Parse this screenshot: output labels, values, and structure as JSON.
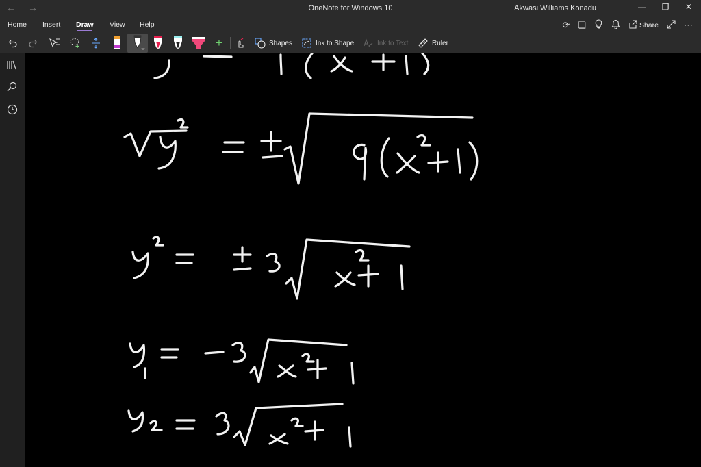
{
  "titlebar": {
    "app_title": "OneNote for Windows 10",
    "user_name": "Akwasi Williams Konadu",
    "back_icon": "back-arrow-icon",
    "forward_icon": "forward-arrow-icon",
    "minimize_glyph": "—",
    "restore_glyph": "❐",
    "close_glyph": "✕"
  },
  "tabs": [
    {
      "label": "Home"
    },
    {
      "label": "Insert"
    },
    {
      "label": "Draw"
    },
    {
      "label": "View"
    },
    {
      "label": "Help"
    }
  ],
  "active_tab": "Draw",
  "header_right": {
    "share_label": "Share"
  },
  "toolbar": {
    "shapes_label": "Shapes",
    "ink_to_shape_label": "Ink to Shape",
    "ink_to_text_label": "Ink to Text",
    "ruler_label": "Ruler",
    "pen_colors": {
      "pen1": "#c13ad1",
      "pen2": "#ffffff",
      "pen3": "#e8204f",
      "pen4": "#ffffff",
      "highlighter": "#f0487a"
    },
    "accent": "#9b7bd4"
  }
}
